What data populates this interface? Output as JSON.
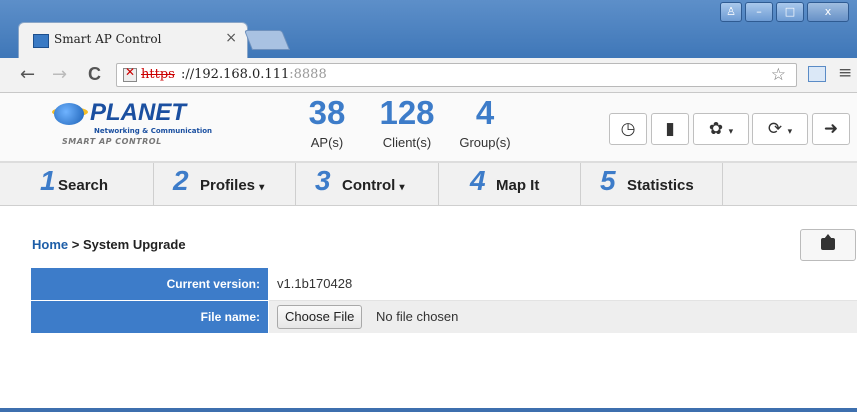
{
  "browser": {
    "tab_title": "Smart AP Control",
    "tab_close": "×",
    "url_scheme": "https",
    "url_host": "://192.168.0.111",
    "url_port": ":8888",
    "back_glyph": "←",
    "forward_glyph": "→",
    "reload_glyph": "C",
    "star_glyph": "☆",
    "menu_glyph": "≡",
    "window_buttons": {
      "minimize": "–",
      "maximize": "□",
      "close": "x"
    }
  },
  "header": {
    "logo_text": "PLANET",
    "logo_subtitle": "Networking & Communication",
    "logo_tagline": "SMART AP CONTROL",
    "stats": [
      {
        "value": "38",
        "label": "AP(s)"
      },
      {
        "value": "128",
        "label": "Client(s)"
      },
      {
        "value": "4",
        "label": "Group(s)"
      }
    ],
    "buttons": {
      "dashboard": "◷",
      "chart": "▮",
      "settings": "✿",
      "refresh": "⟳",
      "logout": "➜",
      "caret": "▾"
    }
  },
  "nav": [
    {
      "num": "1",
      "label": "Search",
      "caret": ""
    },
    {
      "num": "2",
      "label": "Profiles",
      "caret": "▾"
    },
    {
      "num": "3",
      "label": "Control",
      "caret": "▾"
    },
    {
      "num": "4",
      "label": "Map It",
      "caret": ""
    },
    {
      "num": "5",
      "label": "Statistics",
      "caret": ""
    }
  ],
  "breadcrumb": {
    "home": "Home",
    "separator": " > ",
    "current": "System Upgrade"
  },
  "form": {
    "current_version_label": "Current version:",
    "current_version_value": "v1.1b170428",
    "file_name_label": "File name:",
    "choose_file_button": "Choose File",
    "file_status": "No file chosen"
  },
  "colors": {
    "accent": "#3d7cc9",
    "title_bar": "#4a82c2"
  }
}
